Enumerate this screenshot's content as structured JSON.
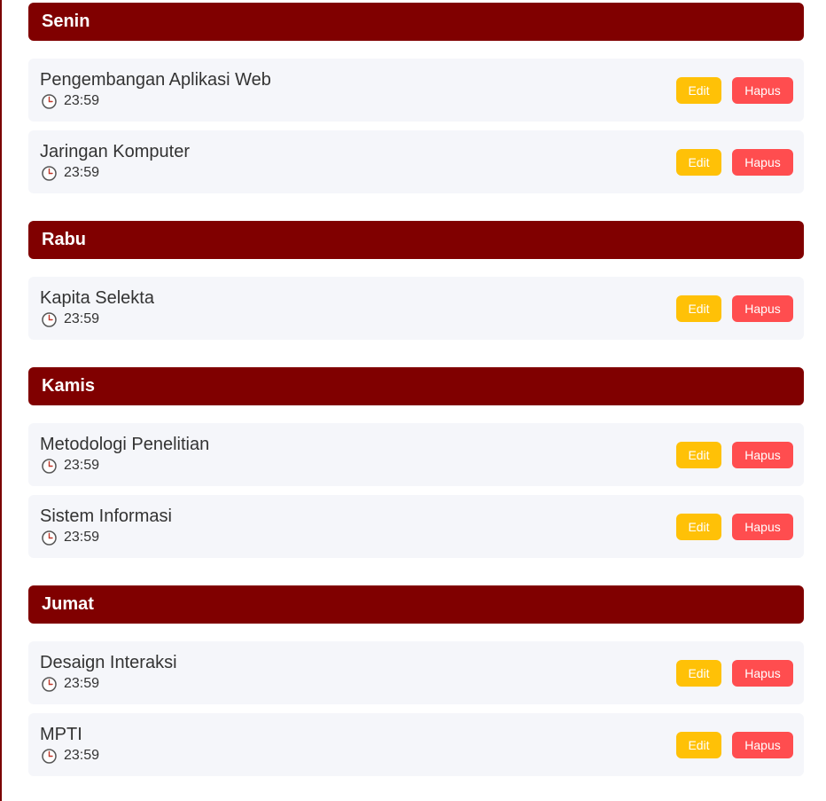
{
  "days": [
    {
      "name": "Senin",
      "tasks": [
        {
          "title": "Pengembangan Aplikasi Web",
          "time": "23:59"
        },
        {
          "title": "Jaringan Komputer",
          "time": "23:59"
        }
      ]
    },
    {
      "name": "Rabu",
      "tasks": [
        {
          "title": "Kapita Selekta",
          "time": "23:59"
        }
      ]
    },
    {
      "name": "Kamis",
      "tasks": [
        {
          "title": "Metodologi Penelitian",
          "time": "23:59"
        },
        {
          "title": "Sistem Informasi",
          "time": "23:59"
        }
      ]
    },
    {
      "name": "Jumat",
      "tasks": [
        {
          "title": "Desaign Interaksi",
          "time": "23:59"
        },
        {
          "title": "MPTI",
          "time": "23:59"
        }
      ]
    }
  ],
  "buttons": {
    "edit_label": "Edit",
    "delete_label": "Hapus"
  },
  "icons": {
    "time": "clock-icon"
  },
  "colors": {
    "header": "#800000",
    "edit": "#ffc107",
    "delete": "#ff4d4f",
    "card": "#f5f6fa"
  }
}
